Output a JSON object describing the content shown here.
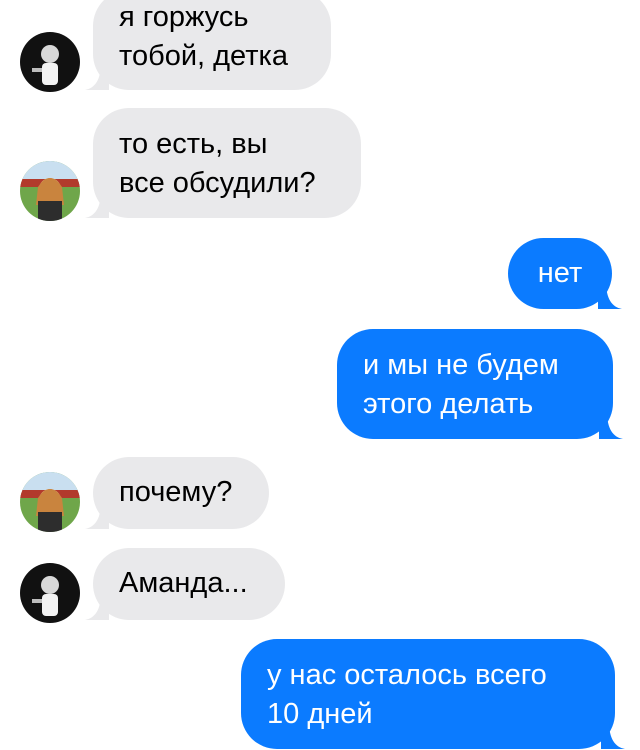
{
  "colors": {
    "incoming_bubble": "#e9e9eb",
    "outgoing_bubble": "#0b7bff",
    "background": "#ffffff"
  },
  "messages": [
    {
      "direction": "incoming",
      "sender_avatar": "avatar-male-bw",
      "lines": [
        "я горжусь",
        "тобой, детка"
      ]
    },
    {
      "direction": "incoming",
      "sender_avatar": "avatar-female-color",
      "lines": [
        "то есть, вы",
        "все обсудили?"
      ]
    },
    {
      "direction": "outgoing",
      "lines": [
        "нет"
      ]
    },
    {
      "direction": "outgoing",
      "lines": [
        "и мы не будем",
        "этого делать"
      ]
    },
    {
      "direction": "incoming",
      "sender_avatar": "avatar-female-color",
      "lines": [
        "почему?"
      ]
    },
    {
      "direction": "incoming",
      "sender_avatar": "avatar-male-bw",
      "lines": [
        "Аманда..."
      ]
    },
    {
      "direction": "outgoing",
      "lines": [
        "у нас осталось всего",
        "10 дней"
      ]
    }
  ]
}
